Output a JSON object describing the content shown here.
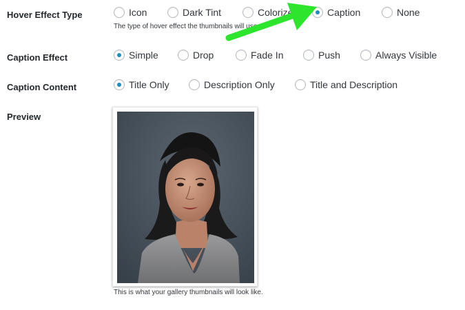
{
  "hover_effect": {
    "label": "Hover Effect Type",
    "options": [
      "Icon",
      "Dark Tint",
      "Colorize",
      "Caption",
      "None"
    ],
    "selected": "Caption",
    "description": "The type of hover effect the thumbnails will use."
  },
  "caption_effect": {
    "label": "Caption Effect",
    "options": [
      "Simple",
      "Drop",
      "Fade In",
      "Push",
      "Always Visible"
    ],
    "selected": "Simple"
  },
  "caption_content": {
    "label": "Caption Content",
    "options": [
      "Title Only",
      "Description Only",
      "Title and Description"
    ],
    "selected": "Title Only"
  },
  "preview": {
    "label": "Preview",
    "caption": "This is what your gallery thumbnails will look like."
  },
  "colors": {
    "radio_checked": "#1e8cbe",
    "arrow": "#2ee52e"
  },
  "icons": {
    "annotation": "green-arrow-icon"
  }
}
